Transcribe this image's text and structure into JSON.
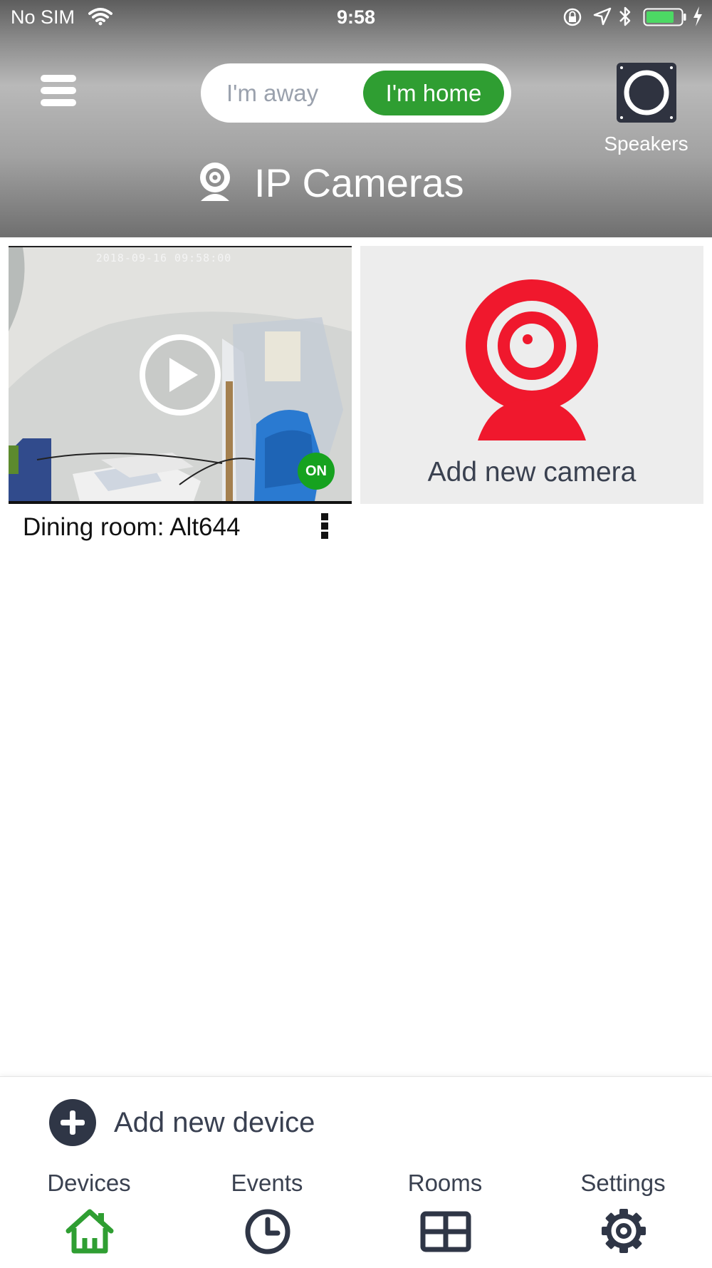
{
  "status_bar": {
    "carrier": "No SIM",
    "time": "9:58"
  },
  "header": {
    "mode_toggle": {
      "away_label": "I'm away",
      "home_label": "I'm home",
      "selected": "I'm home"
    },
    "speakers_label": "Speakers",
    "page_title": "IP Cameras",
    "title_icon": "webcam-icon"
  },
  "cameras": [
    {
      "name": "Dining room: Alt644",
      "timestamp": "2018-09-16 09:58:00",
      "status_badge": "ON"
    }
  ],
  "add_camera": {
    "label": "Add new camera",
    "icon": "webcam-icon"
  },
  "add_device": {
    "label": "Add new device",
    "icon": "plus-circle-icon"
  },
  "tab_bar": {
    "tabs": [
      {
        "label": "Devices",
        "icon": "home-icon",
        "active": true
      },
      {
        "label": "Events",
        "icon": "clock-icon",
        "active": false
      },
      {
        "label": "Rooms",
        "icon": "grid-icon",
        "active": false
      },
      {
        "label": "Settings",
        "icon": "gear-icon",
        "active": false
      }
    ]
  },
  "colors": {
    "accent_green": "#2f9e32",
    "camera_red": "#f0182d",
    "dark_text": "#3a4150"
  }
}
